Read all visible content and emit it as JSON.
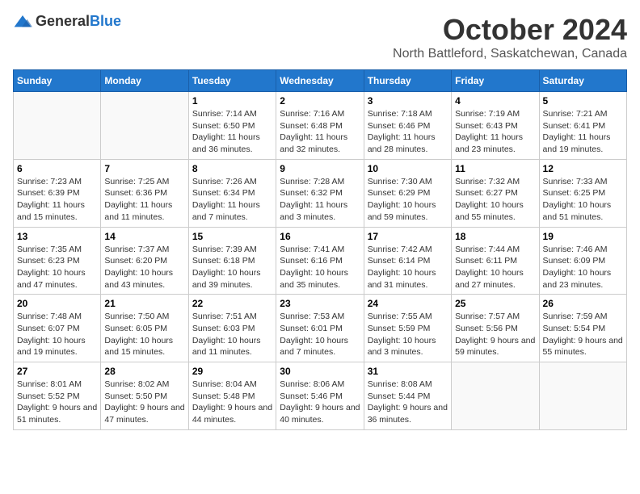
{
  "header": {
    "logo_general": "General",
    "logo_blue": "Blue",
    "month_year": "October 2024",
    "location": "North Battleford, Saskatchewan, Canada"
  },
  "days_of_week": [
    "Sunday",
    "Monday",
    "Tuesday",
    "Wednesday",
    "Thursday",
    "Friday",
    "Saturday"
  ],
  "weeks": [
    [
      {
        "num": "",
        "details": ""
      },
      {
        "num": "",
        "details": ""
      },
      {
        "num": "1",
        "details": "Sunrise: 7:14 AM\nSunset: 6:50 PM\nDaylight: 11 hours and 36 minutes."
      },
      {
        "num": "2",
        "details": "Sunrise: 7:16 AM\nSunset: 6:48 PM\nDaylight: 11 hours and 32 minutes."
      },
      {
        "num": "3",
        "details": "Sunrise: 7:18 AM\nSunset: 6:46 PM\nDaylight: 11 hours and 28 minutes."
      },
      {
        "num": "4",
        "details": "Sunrise: 7:19 AM\nSunset: 6:43 PM\nDaylight: 11 hours and 23 minutes."
      },
      {
        "num": "5",
        "details": "Sunrise: 7:21 AM\nSunset: 6:41 PM\nDaylight: 11 hours and 19 minutes."
      }
    ],
    [
      {
        "num": "6",
        "details": "Sunrise: 7:23 AM\nSunset: 6:39 PM\nDaylight: 11 hours and 15 minutes."
      },
      {
        "num": "7",
        "details": "Sunrise: 7:25 AM\nSunset: 6:36 PM\nDaylight: 11 hours and 11 minutes."
      },
      {
        "num": "8",
        "details": "Sunrise: 7:26 AM\nSunset: 6:34 PM\nDaylight: 11 hours and 7 minutes."
      },
      {
        "num": "9",
        "details": "Sunrise: 7:28 AM\nSunset: 6:32 PM\nDaylight: 11 hours and 3 minutes."
      },
      {
        "num": "10",
        "details": "Sunrise: 7:30 AM\nSunset: 6:29 PM\nDaylight: 10 hours and 59 minutes."
      },
      {
        "num": "11",
        "details": "Sunrise: 7:32 AM\nSunset: 6:27 PM\nDaylight: 10 hours and 55 minutes."
      },
      {
        "num": "12",
        "details": "Sunrise: 7:33 AM\nSunset: 6:25 PM\nDaylight: 10 hours and 51 minutes."
      }
    ],
    [
      {
        "num": "13",
        "details": "Sunrise: 7:35 AM\nSunset: 6:23 PM\nDaylight: 10 hours and 47 minutes."
      },
      {
        "num": "14",
        "details": "Sunrise: 7:37 AM\nSunset: 6:20 PM\nDaylight: 10 hours and 43 minutes."
      },
      {
        "num": "15",
        "details": "Sunrise: 7:39 AM\nSunset: 6:18 PM\nDaylight: 10 hours and 39 minutes."
      },
      {
        "num": "16",
        "details": "Sunrise: 7:41 AM\nSunset: 6:16 PM\nDaylight: 10 hours and 35 minutes."
      },
      {
        "num": "17",
        "details": "Sunrise: 7:42 AM\nSunset: 6:14 PM\nDaylight: 10 hours and 31 minutes."
      },
      {
        "num": "18",
        "details": "Sunrise: 7:44 AM\nSunset: 6:11 PM\nDaylight: 10 hours and 27 minutes."
      },
      {
        "num": "19",
        "details": "Sunrise: 7:46 AM\nSunset: 6:09 PM\nDaylight: 10 hours and 23 minutes."
      }
    ],
    [
      {
        "num": "20",
        "details": "Sunrise: 7:48 AM\nSunset: 6:07 PM\nDaylight: 10 hours and 19 minutes."
      },
      {
        "num": "21",
        "details": "Sunrise: 7:50 AM\nSunset: 6:05 PM\nDaylight: 10 hours and 15 minutes."
      },
      {
        "num": "22",
        "details": "Sunrise: 7:51 AM\nSunset: 6:03 PM\nDaylight: 10 hours and 11 minutes."
      },
      {
        "num": "23",
        "details": "Sunrise: 7:53 AM\nSunset: 6:01 PM\nDaylight: 10 hours and 7 minutes."
      },
      {
        "num": "24",
        "details": "Sunrise: 7:55 AM\nSunset: 5:59 PM\nDaylight: 10 hours and 3 minutes."
      },
      {
        "num": "25",
        "details": "Sunrise: 7:57 AM\nSunset: 5:56 PM\nDaylight: 9 hours and 59 minutes."
      },
      {
        "num": "26",
        "details": "Sunrise: 7:59 AM\nSunset: 5:54 PM\nDaylight: 9 hours and 55 minutes."
      }
    ],
    [
      {
        "num": "27",
        "details": "Sunrise: 8:01 AM\nSunset: 5:52 PM\nDaylight: 9 hours and 51 minutes."
      },
      {
        "num": "28",
        "details": "Sunrise: 8:02 AM\nSunset: 5:50 PM\nDaylight: 9 hours and 47 minutes."
      },
      {
        "num": "29",
        "details": "Sunrise: 8:04 AM\nSunset: 5:48 PM\nDaylight: 9 hours and 44 minutes."
      },
      {
        "num": "30",
        "details": "Sunrise: 8:06 AM\nSunset: 5:46 PM\nDaylight: 9 hours and 40 minutes."
      },
      {
        "num": "31",
        "details": "Sunrise: 8:08 AM\nSunset: 5:44 PM\nDaylight: 9 hours and 36 minutes."
      },
      {
        "num": "",
        "details": ""
      },
      {
        "num": "",
        "details": ""
      }
    ]
  ]
}
